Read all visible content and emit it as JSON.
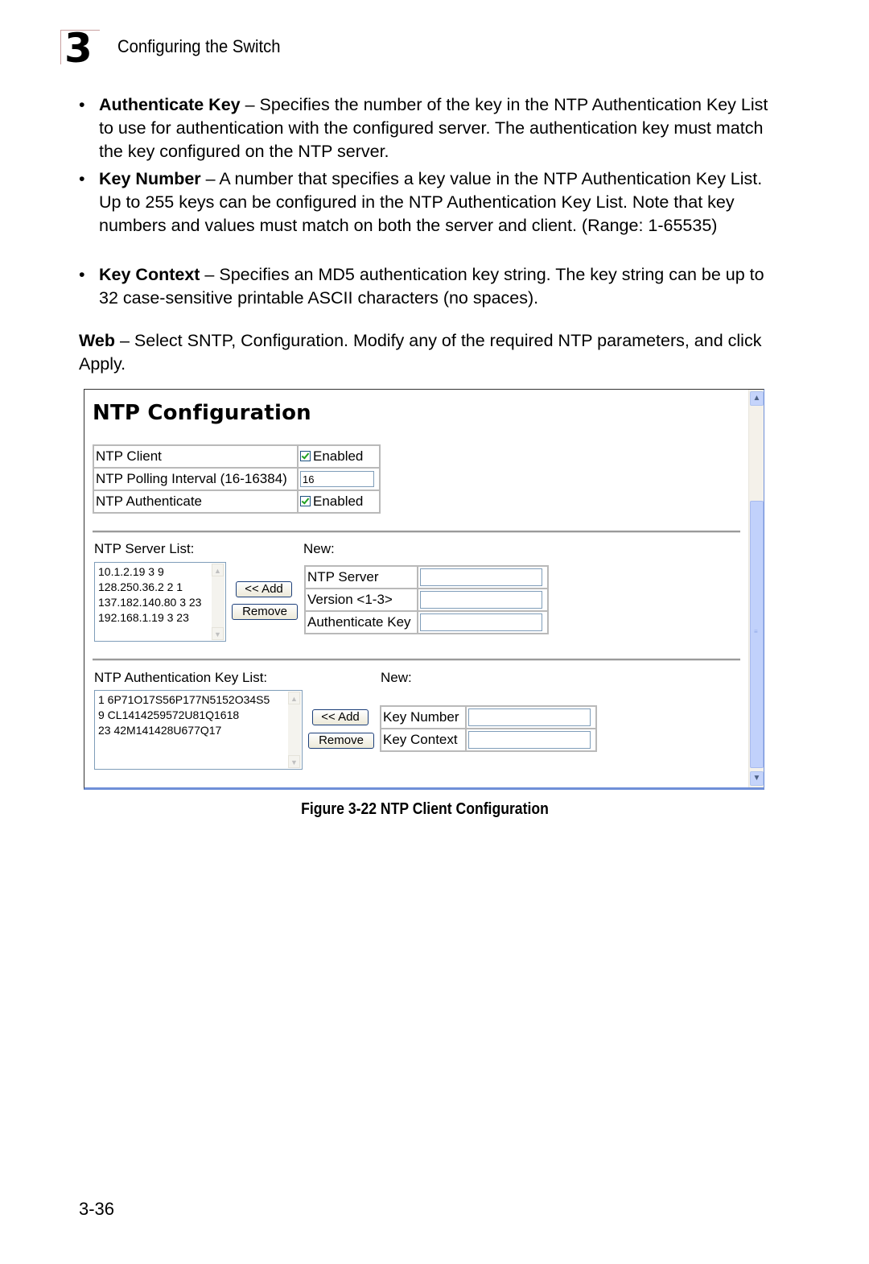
{
  "header": {
    "chapter_number": "3",
    "chapter_title": "Configuring the Switch"
  },
  "bullets": [
    {
      "term": "Authenticate Key",
      "text": " – Specifies the number of the key in the NTP Authentication Key List to use for authentication with the configured server. The authentication key must match the key configured on the NTP server."
    },
    {
      "term": "Key Number",
      "text": " – A number that specifies a key value in the NTP Authentication Key List. Up to 255 keys can be configured in the NTP Authentication Key List. Note that key numbers and values must match on both the server and client. (Range: 1-65535)"
    },
    {
      "term": "Key Context",
      "text": " – Specifies an MD5 authentication key string. The key string can be up to 32 case-sensitive printable ASCII characters (no spaces)."
    }
  ],
  "web_para": {
    "term": "Web",
    "text": " – Select SNTP, Configuration. Modify any of the required NTP parameters, and click Apply."
  },
  "screenshot": {
    "title": "NTP Configuration",
    "config_rows": [
      {
        "label": "NTP Client",
        "type": "checkbox",
        "checked": true,
        "value": "Enabled"
      },
      {
        "label": "NTP Polling Interval (16-16384)",
        "type": "text",
        "value": "16"
      },
      {
        "label": "NTP Authenticate",
        "type": "checkbox",
        "checked": true,
        "value": "Enabled"
      }
    ],
    "server_list": {
      "label": "NTP Server List:",
      "items": [
        "10.1.2.19 3 9",
        "128.250.36.2 2 1",
        "137.182.140.80 3 23",
        "192.168.1.19 3 23"
      ],
      "add_label": "<< Add",
      "remove_label": "Remove",
      "new_label": "New:",
      "new_fields": [
        {
          "label": "NTP Server",
          "value": ""
        },
        {
          "label": "Version <1-3>",
          "value": ""
        },
        {
          "label": "Authenticate Key",
          "value": ""
        }
      ]
    },
    "key_list": {
      "label": "NTP Authentication Key List:",
      "items": [
        "1 6P71O17S56P177N5152O34S5",
        "9 CL1414259572U81Q1618",
        "23 42M141428U677Q17"
      ],
      "add_label": "<< Add",
      "remove_label": "Remove",
      "new_label": "New:",
      "new_fields": [
        {
          "label": "Key Number",
          "value": ""
        },
        {
          "label": "Key Context",
          "value": ""
        }
      ]
    }
  },
  "caption": "Figure 3-22  NTP Client Configuration",
  "page_number": "3-36",
  "colors": {
    "scrollbar_thumb": "#c1d1fb",
    "frame_accent": "#6f8fd8",
    "checkbox_check": "#21a121"
  }
}
